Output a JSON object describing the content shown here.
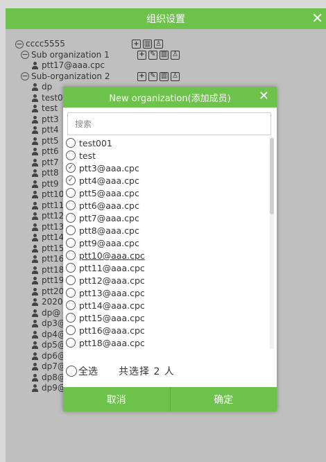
{
  "colors": {
    "accent": "#6cc24a",
    "overlay": "#bfbfbf"
  },
  "outer": {
    "title": "组织设置",
    "close_icon": "✕",
    "tree": [
      {
        "label": "cccc5555",
        "kind": "org",
        "ops": [
          "add-icon",
          "delete-icon",
          "member-icon"
        ]
      },
      {
        "label": "Sub organization 1",
        "kind": "org",
        "ops": [
          "add-icon",
          "edit-icon",
          "delete-icon",
          "member-icon"
        ]
      },
      {
        "label": "ptt17@aaa.cpc",
        "kind": "user"
      },
      {
        "label": "Sub-organization 2",
        "kind": "org",
        "ops": [
          "add-icon",
          "edit-icon",
          "delete-icon",
          "member-icon"
        ]
      },
      {
        "label": "dp",
        "kind": "user"
      },
      {
        "label": "test0",
        "kind": "user"
      },
      {
        "label": "test",
        "kind": "user"
      },
      {
        "label": "ptt3",
        "kind": "user"
      },
      {
        "label": "ptt4",
        "kind": "user"
      },
      {
        "label": "ptt5",
        "kind": "user"
      },
      {
        "label": "ptt6",
        "kind": "user"
      },
      {
        "label": "ptt7",
        "kind": "user"
      },
      {
        "label": "ptt8",
        "kind": "user"
      },
      {
        "label": "ptt9",
        "kind": "user"
      },
      {
        "label": "ptt10",
        "kind": "user"
      },
      {
        "label": "ptt11",
        "kind": "user"
      },
      {
        "label": "ptt12",
        "kind": "user"
      },
      {
        "label": "ptt13",
        "kind": "user"
      },
      {
        "label": "ptt14",
        "kind": "user"
      },
      {
        "label": "ptt15",
        "kind": "user"
      },
      {
        "label": "ptt16",
        "kind": "user"
      },
      {
        "label": "ptt18",
        "kind": "user"
      },
      {
        "label": "ptt19",
        "kind": "user"
      },
      {
        "label": "ptt20",
        "kind": "user"
      },
      {
        "label": "2020",
        "kind": "user"
      },
      {
        "label": "dp@",
        "kind": "user"
      },
      {
        "label": "dp3@",
        "kind": "user"
      },
      {
        "label": "dp4@",
        "kind": "user"
      },
      {
        "label": "dp5@",
        "kind": "user"
      },
      {
        "label": "dp6@aaa.cpc",
        "kind": "user"
      },
      {
        "label": "dp7@aaa.cpc",
        "kind": "user"
      },
      {
        "label": "dp8@aaa.cpc",
        "kind": "user"
      },
      {
        "label": "dp9@aaa.cpc",
        "kind": "user"
      }
    ]
  },
  "modal": {
    "title": "New organization(添加成员)",
    "close_icon": "✕",
    "search": {
      "placeholder": "搜索",
      "value": ""
    },
    "items": [
      {
        "label": "test001",
        "checked": false
      },
      {
        "label": "test",
        "checked": false
      },
      {
        "label": "ptt3@aaa.cpc",
        "checked": true
      },
      {
        "label": "ptt4@aaa.cpc",
        "checked": true
      },
      {
        "label": "ptt5@aaa.cpc",
        "checked": false
      },
      {
        "label": "ptt6@aaa.cpc",
        "checked": false
      },
      {
        "label": "ptt7@aaa.cpc",
        "checked": false
      },
      {
        "label": "ptt8@aaa.cpc",
        "checked": false
      },
      {
        "label": "ptt9@aaa.cpc",
        "checked": false
      },
      {
        "label": "ptt10@aaa.cpc",
        "checked": false,
        "underlined": true
      },
      {
        "label": "ptt11@aaa.cpc",
        "checked": false
      },
      {
        "label": "ptt12@aaa.cpc",
        "checked": false
      },
      {
        "label": "ptt13@aaa.cpc",
        "checked": false
      },
      {
        "label": "ptt14@aaa.cpc",
        "checked": false
      },
      {
        "label": "ptt15@aaa.cpc",
        "checked": false
      },
      {
        "label": "ptt16@aaa.cpc",
        "checked": false
      },
      {
        "label": "ptt18@aaa.cpc",
        "checked": false
      }
    ],
    "select_all_label": "全选",
    "selected_count_text": "共选择 2 人",
    "cancel_label": "取消",
    "confirm_label": "确定"
  }
}
